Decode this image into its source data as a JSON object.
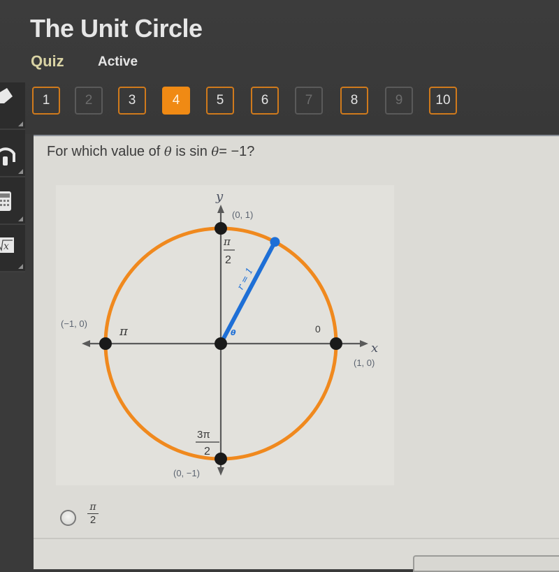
{
  "header": {
    "title": "The Unit Circle",
    "mode_label": "Quiz",
    "status_label": "Active"
  },
  "question_nav": [
    {
      "label": "1",
      "state": "answered"
    },
    {
      "label": "2",
      "state": "disabled"
    },
    {
      "label": "3",
      "state": "answered"
    },
    {
      "label": "4",
      "state": "current"
    },
    {
      "label": "5",
      "state": "answered"
    },
    {
      "label": "6",
      "state": "answered"
    },
    {
      "label": "7",
      "state": "disabled"
    },
    {
      "label": "8",
      "state": "answered"
    },
    {
      "label": "9",
      "state": "disabled"
    },
    {
      "label": "10",
      "state": "answered"
    }
  ],
  "side_tools": [
    {
      "name": "pencil-icon"
    },
    {
      "name": "headphones-icon"
    },
    {
      "name": "calculator-icon"
    },
    {
      "name": "formula-icon"
    }
  ],
  "question": {
    "prefix": "For which value of ",
    "theta": "θ",
    "middle": " is sin ",
    "theta2": "θ",
    "suffix": "= −1?"
  },
  "diagram": {
    "y_axis_label": "y",
    "x_axis_label": "x",
    "points": {
      "top": "(0, 1)",
      "left": "(−1, 0)",
      "right": "(1, 0)",
      "bottom": "(0, −1)"
    },
    "angles": {
      "right": "0",
      "left": "π",
      "top_num": "π",
      "top_den": "2",
      "bottom_num": "3π",
      "bottom_den": "2"
    },
    "radius_label": "r = 1",
    "angle_label": "θ",
    "colors": {
      "circle": "#f0891e",
      "radius": "#1e6fd6",
      "axis": "#5a5a5a",
      "point": "#1a1a1a",
      "label": "#5b6370"
    }
  },
  "answers": [
    {
      "num": "π",
      "den": "2",
      "selected": false
    }
  ],
  "colors": {
    "accent": "#f08a14",
    "background": "#3a3a3a",
    "panel": "#dcdbd6"
  }
}
